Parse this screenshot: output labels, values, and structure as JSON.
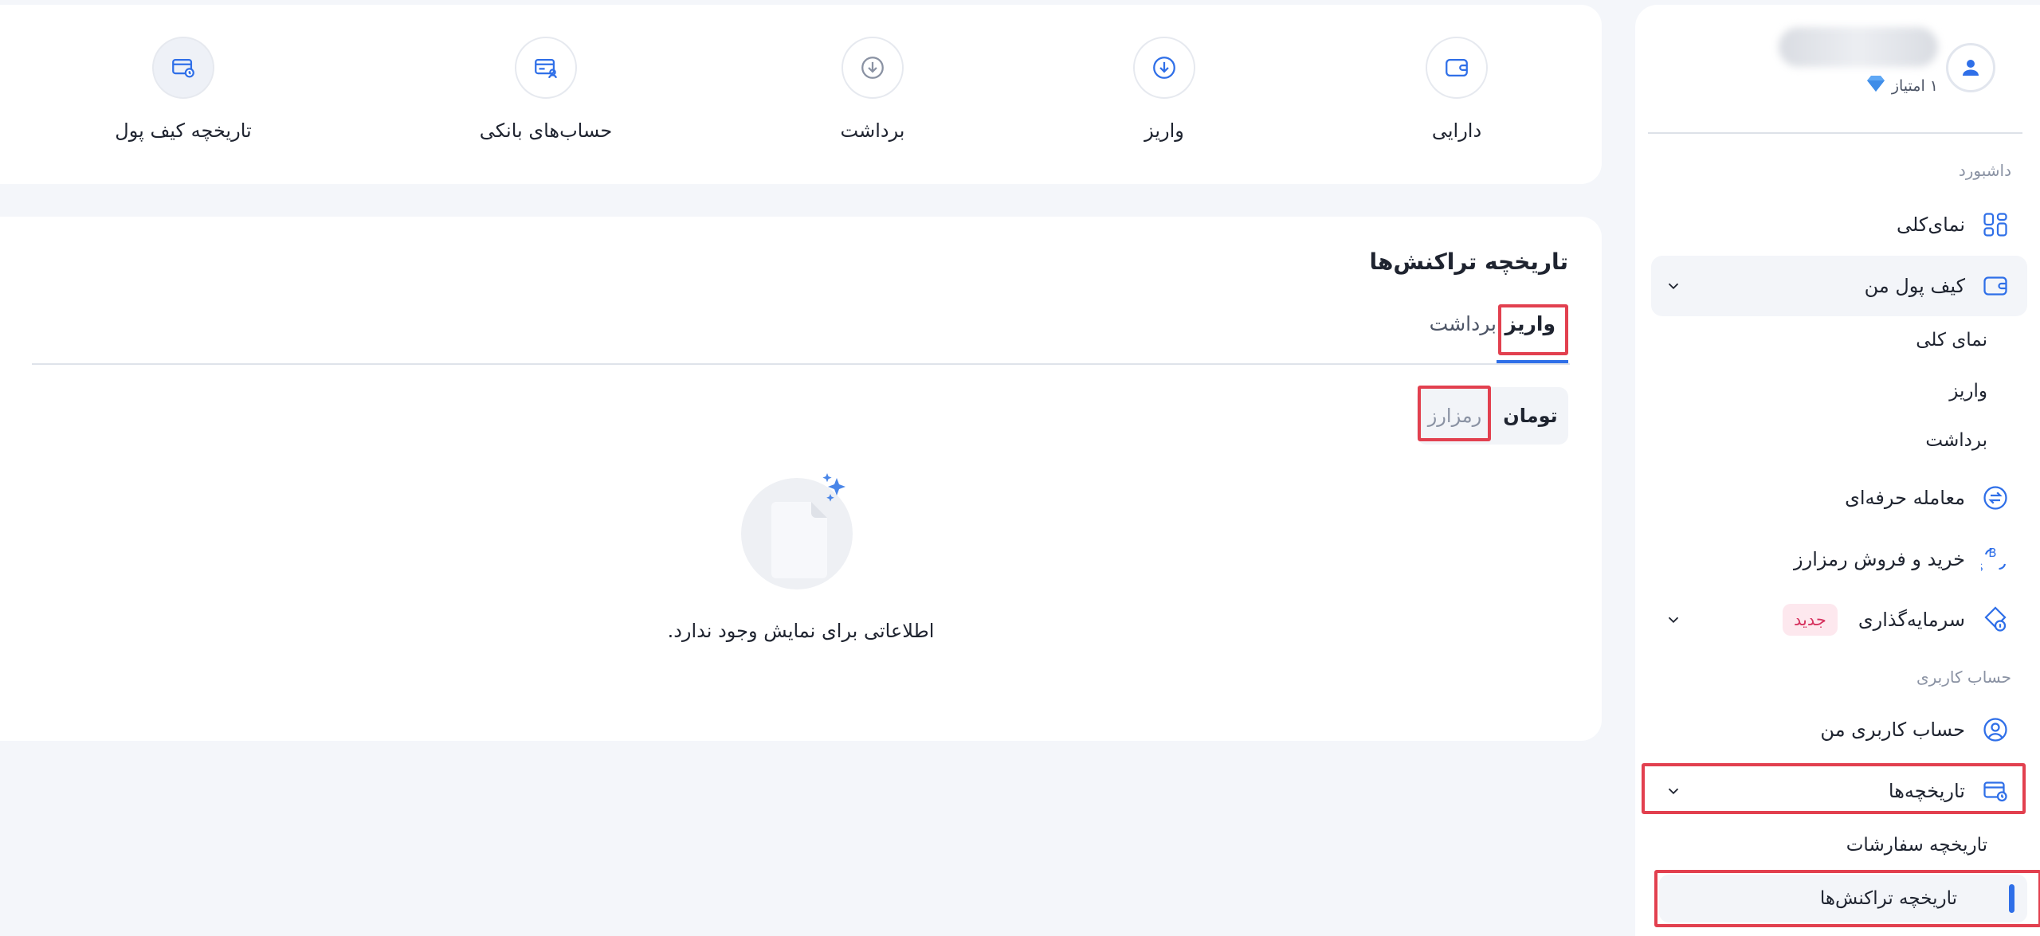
{
  "profile": {
    "points_label": "۱ امتیاز"
  },
  "sidebar": {
    "section_dashboard": "داشبورد",
    "overview": "نمای‌کلی",
    "my_wallet": "کیف پول من",
    "wallet_sub": [
      "نمای کلی",
      "واریز",
      "برداشت"
    ],
    "pro_trade": "معامله حرفه‌ای",
    "buy_sell": "خرید و فروش رمزارز",
    "investment": "سرمایه‌گذاری",
    "new_badge": "جدید",
    "section_account": "حساب کاربری",
    "my_account": "حساب کاربری من",
    "histories": "تاریخچه‌ها",
    "orders_history": "تاریخچه سفارشات",
    "transactions_history": "تاریخچه تراکنش‌ها"
  },
  "shortcuts": {
    "assets": "دارایی",
    "deposit": "واریز",
    "withdraw": "برداشت",
    "bank_accounts": "حساب‌های بانکی",
    "wallet_history": "تاریخچه کیف پول"
  },
  "history": {
    "title": "تاریخچه تراکنش‌ها",
    "tab_deposit": "واریز",
    "tab_withdraw": "برداشت",
    "seg_toman": "تومان",
    "seg_crypto": "رمزارز",
    "empty": "اطلاعاتی برای نمایش وجود ندارد."
  },
  "colors": {
    "accent": "#2f6fe8",
    "highlight": "#e2404f",
    "badge": "#d6335f"
  }
}
